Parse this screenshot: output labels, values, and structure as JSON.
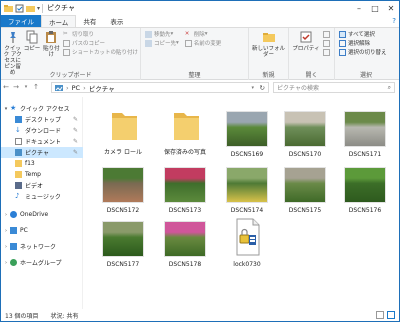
{
  "window": {
    "title": "ピクチャ"
  },
  "ribbon_tabs": [
    "ファイル",
    "ホーム",
    "共有",
    "表示"
  ],
  "ribbon": {
    "clipboard": {
      "label": "クリップボード",
      "pin": "クイック アクセスにピン留め",
      "copy": "コピー",
      "paste": "貼り付け",
      "cut": "切り取り",
      "copy_path": "パスのコピー",
      "paste_shortcut": "ショートカットの貼り付け"
    },
    "organize": {
      "label": "整理",
      "move_to": "移動先",
      "copy_to": "コピー先",
      "delete": "削除",
      "rename": "名前の変更"
    },
    "new": {
      "label": "新規",
      "new_folder": "新しいフォルダー"
    },
    "open": {
      "label": "開く",
      "properties": "プロパティ"
    },
    "select": {
      "label": "選択",
      "select_all": "すべて選択",
      "select_none": "選択解除",
      "invert": "選択の切り替え"
    }
  },
  "address": {
    "root": "PC",
    "current": "ピクチャ",
    "search_placeholder": "ピクチャの検索"
  },
  "nav": {
    "quick_access": "クイック アクセス",
    "desktop": "デスクトップ",
    "downloads": "ダウンロード",
    "documents": "ドキュメント",
    "pictures": "ピクチャ",
    "f13": "f13",
    "temp": "Temp",
    "video": "ビデオ",
    "music": "ミュージック",
    "onedrive": "OneDrive",
    "pc": "PC",
    "network": "ネットワーク",
    "homegroup": "ホームグループ"
  },
  "items": [
    {
      "name": "カメラ ロール",
      "type": "folder"
    },
    {
      "name": "保存済みの写真",
      "type": "folder"
    },
    {
      "name": "DSCN5169",
      "type": "photo",
      "colors": [
        "#5b8a3a",
        "#9aa6b0",
        "#3d5e28"
      ]
    },
    {
      "name": "DSCN5170",
      "type": "photo",
      "colors": [
        "#6f8f5a",
        "#c8c2b4",
        "#4a6a32"
      ]
    },
    {
      "name": "DSCN5171",
      "type": "photo",
      "colors": [
        "#b8b8b0",
        "#6c8a4a",
        "#8c8c86"
      ]
    },
    {
      "name": "DSCN5172",
      "type": "photo",
      "colors": [
        "#7a6a52",
        "#4c7a34",
        "#b07a5a"
      ]
    },
    {
      "name": "DSCN5173",
      "type": "photo",
      "colors": [
        "#3f6e2c",
        "#c23c60",
        "#5c8a3c"
      ]
    },
    {
      "name": "DSCN5174",
      "type": "photo",
      "colors": [
        "#4e7a36",
        "#8aa86a",
        "#d8c24a"
      ]
    },
    {
      "name": "DSCN5175",
      "type": "photo",
      "colors": [
        "#6a8a48",
        "#a6a292",
        "#3f6a28"
      ]
    },
    {
      "name": "DSCN5176",
      "type": "photo",
      "colors": [
        "#3c6e28",
        "#5c9a3a",
        "#2e5a1e"
      ]
    },
    {
      "name": "DSCN5177",
      "type": "photo",
      "colors": [
        "#4a7a30",
        "#8a9a6a",
        "#2c5a1c"
      ]
    },
    {
      "name": "DSCN5178",
      "type": "photo",
      "colors": [
        "#6a8a40",
        "#d0569a",
        "#3e6a26"
      ]
    },
    {
      "name": "lock0730",
      "type": "file"
    }
  ],
  "status": {
    "count": "13 個の項目",
    "share": "状況: 共有"
  },
  "colors": {
    "accent": "#1979ca",
    "selected": "#cce8ff",
    "folder": "#f4c95d"
  }
}
